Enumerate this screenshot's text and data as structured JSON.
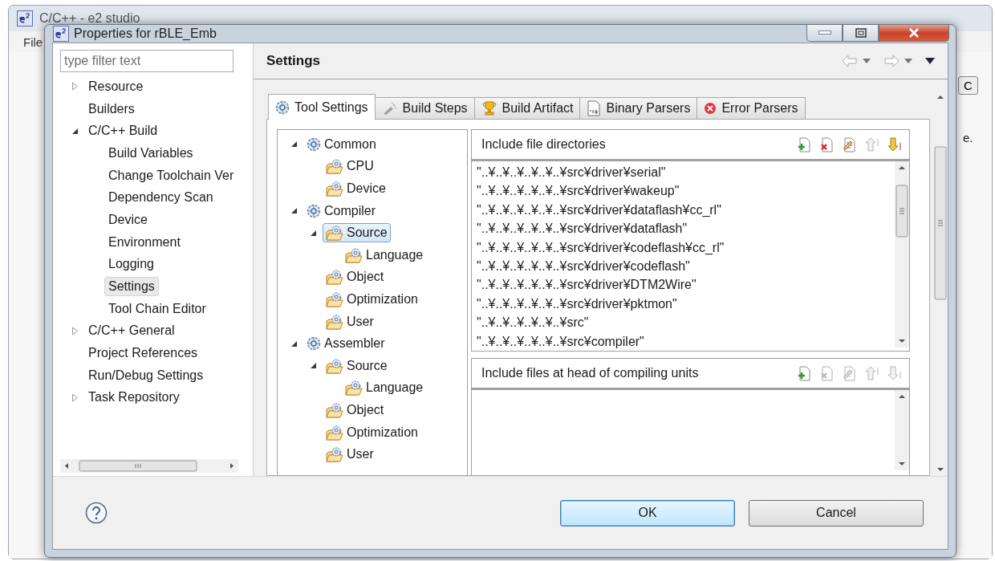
{
  "background_window": {
    "title": "C/C++ - e2 studio",
    "menu": [
      "File"
    ],
    "side_button": "C",
    "side_text": "e."
  },
  "window": {
    "title": "Properties for rBLE_Emb"
  },
  "filter": {
    "placeholder": "type filter text"
  },
  "nav": [
    {
      "label": "Resource",
      "expanded": false,
      "selected": false
    },
    {
      "label": "Builders",
      "selected": false
    },
    {
      "label": "C/C++ Build",
      "expanded": true,
      "selected": false,
      "children": [
        {
          "label": "Build Variables",
          "selected": false
        },
        {
          "label": "Change Toolchain Ver",
          "selected": false
        },
        {
          "label": "Dependency Scan",
          "selected": false
        },
        {
          "label": "Device",
          "selected": false
        },
        {
          "label": "Environment",
          "selected": false
        },
        {
          "label": "Logging",
          "selected": false
        },
        {
          "label": "Settings",
          "selected": true
        },
        {
          "label": "Tool Chain Editor",
          "selected": false
        }
      ]
    },
    {
      "label": "C/C++ General",
      "expanded": false,
      "selected": false
    },
    {
      "label": "Project References",
      "selected": false
    },
    {
      "label": "Run/Debug Settings",
      "selected": false
    },
    {
      "label": "Task Repository",
      "expanded": false,
      "selected": false
    }
  ],
  "page_title": "Settings",
  "tabs": [
    {
      "label": "Tool Settings",
      "kind": "gear",
      "selected": true
    },
    {
      "label": "Build Steps",
      "kind": "brush",
      "selected": false
    },
    {
      "label": "Build Artifact",
      "kind": "trophy",
      "selected": false
    },
    {
      "label": "Binary Parsers",
      "kind": "binary",
      "selected": false
    },
    {
      "label": "Error Parsers",
      "kind": "error",
      "selected": false
    }
  ],
  "tool_tree": [
    {
      "label": "Common",
      "kind": "tool",
      "expanded": true,
      "selected": false,
      "children": [
        {
          "label": "CPU",
          "kind": "option",
          "selected": false
        },
        {
          "label": "Device",
          "kind": "option",
          "selected": false
        }
      ]
    },
    {
      "label": "Compiler",
      "kind": "tool",
      "expanded": true,
      "selected": false,
      "children": [
        {
          "label": "Source",
          "kind": "option",
          "expanded": true,
          "selected": true,
          "children": [
            {
              "label": "Language",
              "kind": "option",
              "selected": false
            }
          ]
        },
        {
          "label": "Object",
          "kind": "option",
          "selected": false
        },
        {
          "label": "Optimization",
          "kind": "option",
          "selected": false
        },
        {
          "label": "User",
          "kind": "option",
          "selected": false
        }
      ]
    },
    {
      "label": "Assembler",
      "kind": "tool",
      "expanded": true,
      "selected": false,
      "children": [
        {
          "label": "Source",
          "kind": "option",
          "expanded": true,
          "selected": false,
          "children": [
            {
              "label": "Language",
              "kind": "option",
              "selected": false
            }
          ]
        },
        {
          "label": "Object",
          "kind": "option",
          "selected": false
        },
        {
          "label": "Optimization",
          "kind": "option",
          "selected": false
        },
        {
          "label": "User",
          "kind": "option",
          "selected": false
        }
      ]
    }
  ],
  "lists": [
    {
      "title": "Include file directories",
      "tools": [
        {
          "kind": "add",
          "disabled": false
        },
        {
          "kind": "delete",
          "disabled": false
        },
        {
          "kind": "edit",
          "disabled": false
        },
        {
          "kind": "up",
          "disabled": true
        },
        {
          "kind": "down",
          "disabled": false
        }
      ],
      "items": [
        "\"..¥..¥..¥..¥..¥..¥src¥driver¥serial\"",
        "\"..¥..¥..¥..¥..¥..¥src¥driver¥wakeup\"",
        "\"..¥..¥..¥..¥..¥..¥src¥driver¥dataflash¥cc_rl\"",
        "\"..¥..¥..¥..¥..¥..¥src¥driver¥dataflash\"",
        "\"..¥..¥..¥..¥..¥..¥src¥driver¥codeflash¥cc_rl\"",
        "\"..¥..¥..¥..¥..¥..¥src¥driver¥codeflash\"",
        "\"..¥..¥..¥..¥..¥..¥src¥driver¥DTM2Wire\"",
        "\"..¥..¥..¥..¥..¥..¥src¥driver¥pktmon\"",
        "\"..¥..¥..¥..¥..¥..¥src\"",
        "\"..¥..¥..¥..¥..¥..¥src¥compiler\""
      ]
    },
    {
      "title": "Include files at head of compiling units",
      "tools": [
        {
          "kind": "add",
          "disabled": false
        },
        {
          "kind": "delete",
          "disabled": true
        },
        {
          "kind": "edit",
          "disabled": true
        },
        {
          "kind": "up",
          "disabled": true
        },
        {
          "kind": "down",
          "disabled": true
        }
      ]
    }
  ],
  "buttons": [
    {
      "label": "OK",
      "default": true
    },
    {
      "label": "Cancel",
      "default": false
    }
  ]
}
